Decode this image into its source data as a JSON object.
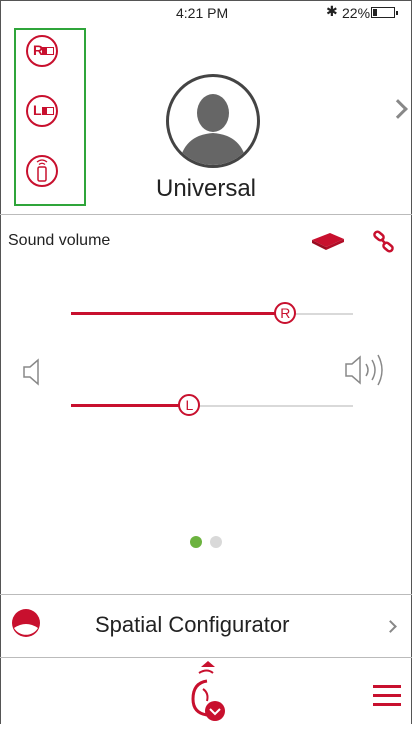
{
  "status_bar": {
    "time": "4:21 PM",
    "bluetooth_icon": "bluetooth-icon",
    "battery_percent": "22%",
    "battery_level": 0.22
  },
  "devices": [
    {
      "side": "R",
      "icon": "right-hearing-aid-battery-icon"
    },
    {
      "side": "L",
      "icon": "left-hearing-aid-battery-icon"
    },
    {
      "icon": "phone-streaming-icon"
    }
  ],
  "profile": {
    "name": "Universal",
    "avatar_icon": "user-silhouette-icon"
  },
  "volume": {
    "title": "Sound volume",
    "right": {
      "label": "R",
      "level": 0.76
    },
    "left": {
      "label": "L",
      "level": 0.42
    }
  },
  "pager": {
    "pages": 2,
    "active": 0
  },
  "spatial": {
    "label": "Spatial Configurator"
  },
  "colors": {
    "accent": "#c8102e",
    "highlight": "#2fa53a",
    "pager_active": "#6cb33f",
    "pager_inactive": "#d9d9d9"
  }
}
